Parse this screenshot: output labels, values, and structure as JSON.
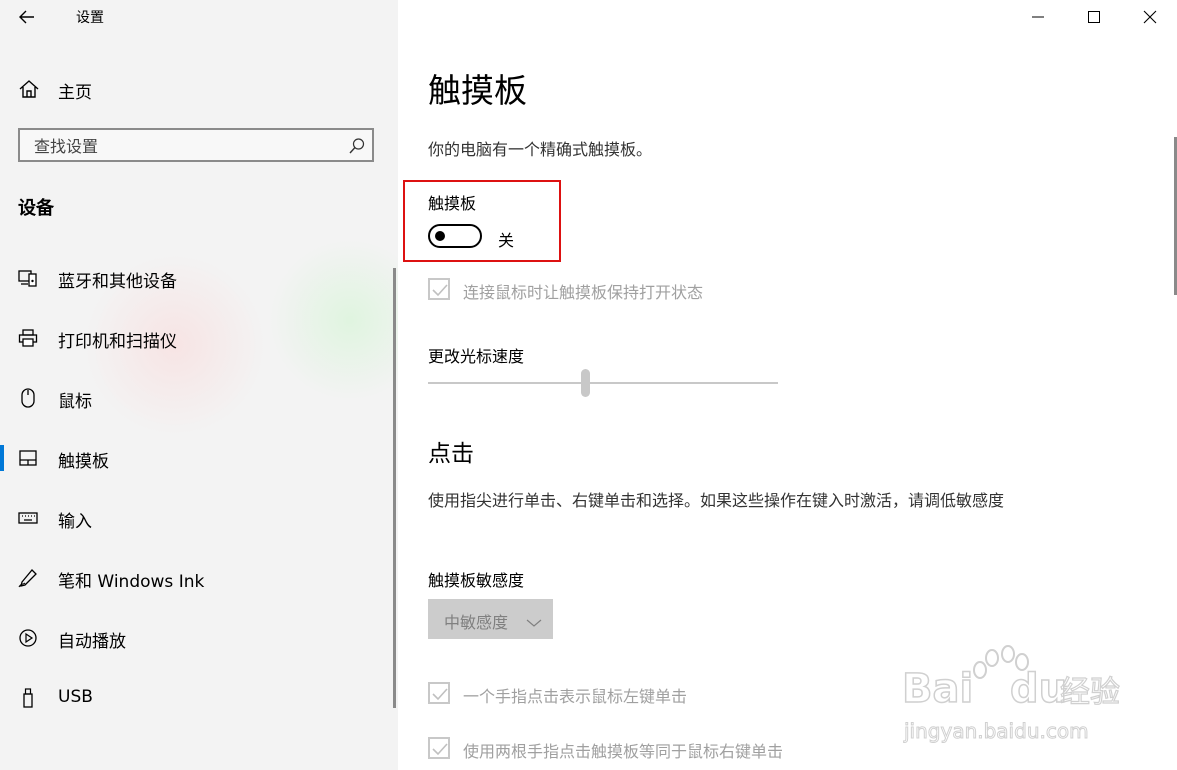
{
  "window": {
    "title": "设置",
    "controls": [
      "minimize",
      "maximize",
      "close"
    ]
  },
  "sidebar": {
    "home_label": "主页",
    "search_placeholder": "查找设置",
    "section_title": "设备",
    "items": [
      {
        "label": "蓝牙和其他设备",
        "icon": "bluetooth-devices-icon"
      },
      {
        "label": "打印机和扫描仪",
        "icon": "printer-icon"
      },
      {
        "label": "鼠标",
        "icon": "mouse-icon"
      },
      {
        "label": "触摸板",
        "icon": "touchpad-icon",
        "active": true
      },
      {
        "label": "输入",
        "icon": "keyboard-icon"
      },
      {
        "label": "笔和 Windows Ink",
        "icon": "pen-icon"
      },
      {
        "label": "自动播放",
        "icon": "autoplay-icon"
      },
      {
        "label": "USB",
        "icon": "usb-icon"
      }
    ]
  },
  "main": {
    "title": "触摸板",
    "description": "你的电脑有一个精确式触摸板。",
    "toggle": {
      "heading": "触摸板",
      "state": "关",
      "on": false
    },
    "keep_on_with_mouse": {
      "label": "连接鼠标时让触摸板保持打开状态",
      "checked": true,
      "disabled": true
    },
    "cursor_speed": {
      "label": "更改光标速度",
      "value_fraction": 0.45
    },
    "taps": {
      "heading": "点击",
      "description": "使用指尖进行单击、右键单击和选择。如果这些操作在键入时激活，请调低敏感度",
      "sensitivity_label": "触摸板敏感度",
      "sensitivity_value": "中敏感度",
      "options": [
        {
          "label": "一个手指点击表示鼠标左键单击",
          "checked": true
        },
        {
          "label": "使用两根手指点击触摸板等同于鼠标右键单击",
          "checked": true
        }
      ]
    }
  },
  "watermark": {
    "brand": "Baidu经验",
    "url": "jingyan.baidu.com"
  },
  "colors": {
    "accent": "#0078d7",
    "highlight_border": "#dd1111",
    "disabled": "#a0a0a0"
  }
}
